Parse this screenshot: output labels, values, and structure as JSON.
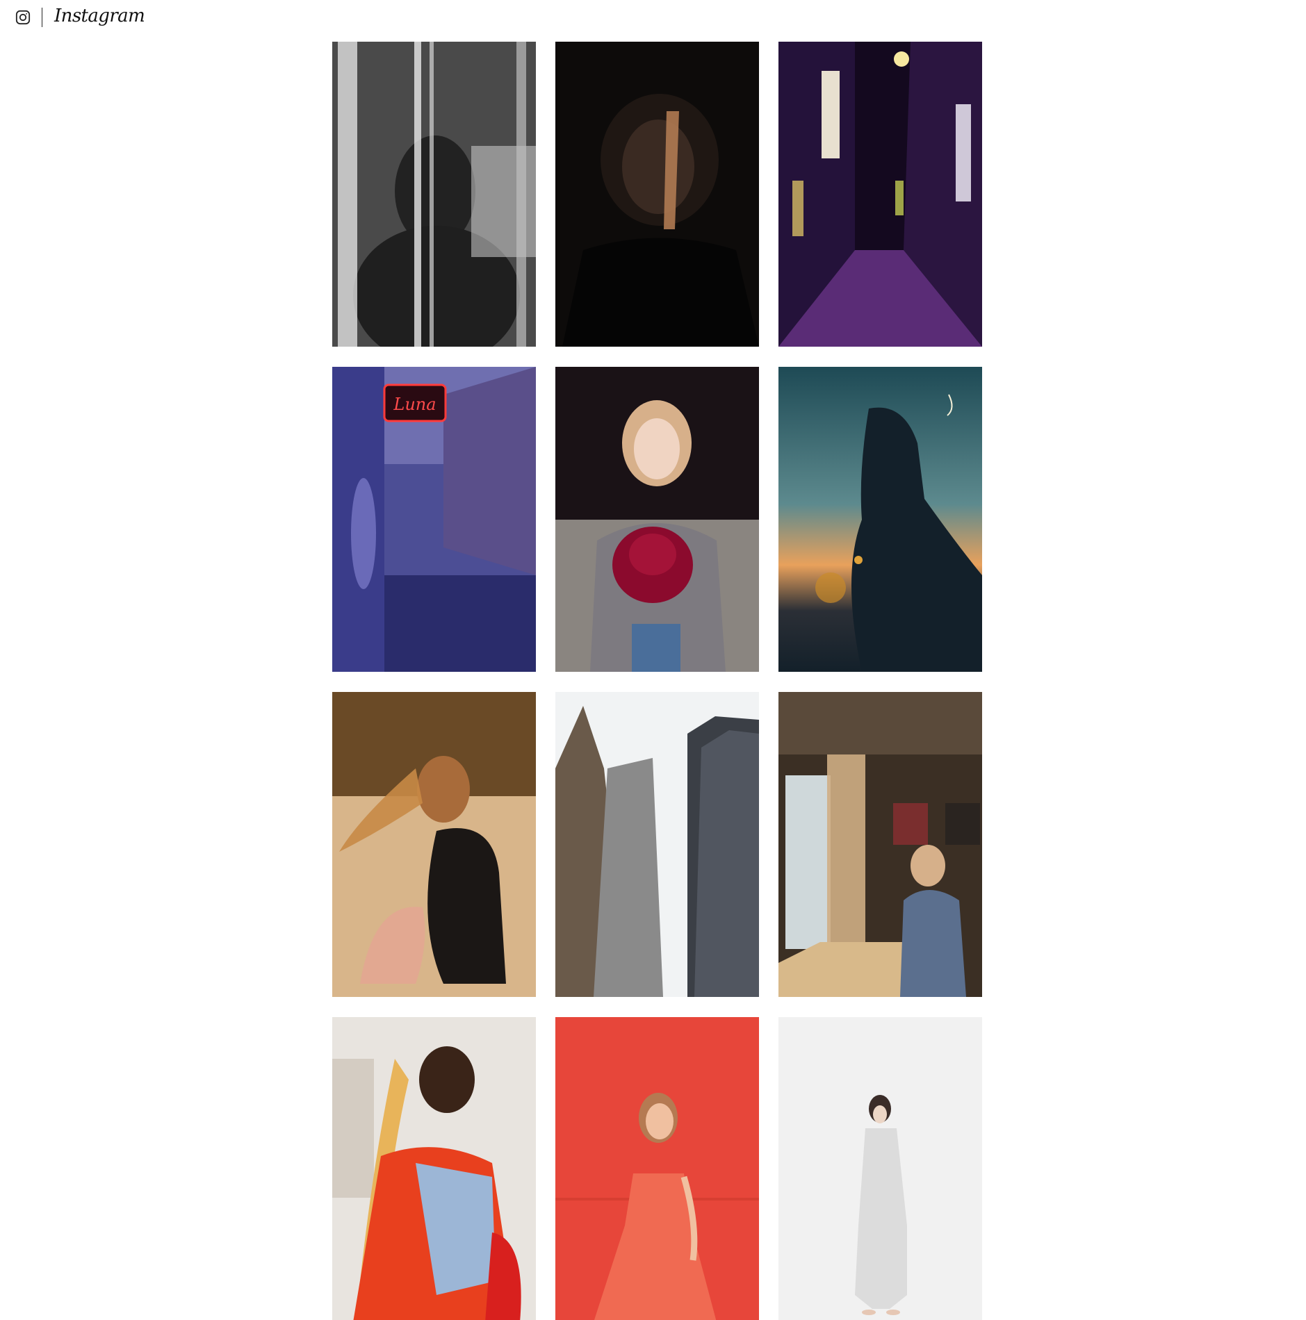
{
  "header": {
    "logo_icon": "instagram-glyph-icon",
    "wordmark": "Instagram"
  },
  "grid": {
    "photos": [
      {
        "subject": "portrait-behind-glass",
        "palette": [
          "#2b2b2b",
          "#8a8a8a",
          "#d9d9d9"
        ]
      },
      {
        "subject": "portrait-light-strip",
        "palette": [
          "#0d0b0a",
          "#3a2a22",
          "#b07a52"
        ]
      },
      {
        "subject": "neon-alley-night",
        "palette": [
          "#14091f",
          "#5a2c76",
          "#f0d36a"
        ]
      },
      {
        "subject": "luna-neon-street",
        "palette": [
          "#2a2c6b",
          "#6f6fb0",
          "#ff3b3b"
        ],
        "sign_text": "Luna"
      },
      {
        "subject": "woman-with-red-hat",
        "palette": [
          "#1a1216",
          "#7d7a80",
          "#8b0a2d"
        ]
      },
      {
        "subject": "silhouette-sunset-moon",
        "palette": [
          "#1e4a55",
          "#e8a15c",
          "#13202a"
        ]
      },
      {
        "subject": "woman-on-beach-sunset",
        "palette": [
          "#6a4a26",
          "#d8b58a",
          "#1b1715"
        ]
      },
      {
        "subject": "skyscrapers-looking-up",
        "palette": [
          "#f1f3f4",
          "#8a8a8a",
          "#3b3f46"
        ]
      },
      {
        "subject": "woman-by-window-room",
        "palette": [
          "#3b2f24",
          "#cfae84",
          "#5b6f8e"
        ]
      },
      {
        "subject": "woman-braids-red-jacket",
        "palette": [
          "#e8e4df",
          "#e8401e",
          "#9cb6d6"
        ]
      },
      {
        "subject": "woman-red-dress-red-wall",
        "palette": [
          "#e7463a",
          "#f06a52",
          "#c9321f"
        ]
      },
      {
        "subject": "woman-white-outfit",
        "palette": [
          "#f1f1f1",
          "#dcdcdc",
          "#3a2c28"
        ]
      }
    ]
  }
}
